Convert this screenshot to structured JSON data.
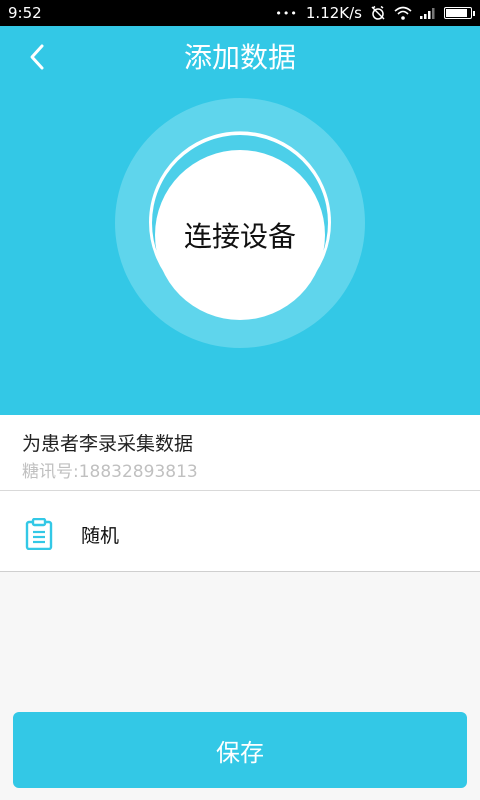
{
  "status_bar": {
    "time": "9:52",
    "dots": "•••",
    "network_speed": "1.12K/s",
    "battery_level": 0.9
  },
  "header": {
    "title": "添加数据",
    "connect_label": "连接设备"
  },
  "patient": {
    "collect_text": "为患者李录采集数据",
    "phone_text": "糖讯号:18832893813"
  },
  "mode": {
    "label": "随机",
    "icon": "clipboard-icon"
  },
  "save_label": "保存",
  "colors": {
    "accent": "#33c8e6",
    "ring_outer": "#5fd5ec",
    "white": "#ffffff"
  }
}
